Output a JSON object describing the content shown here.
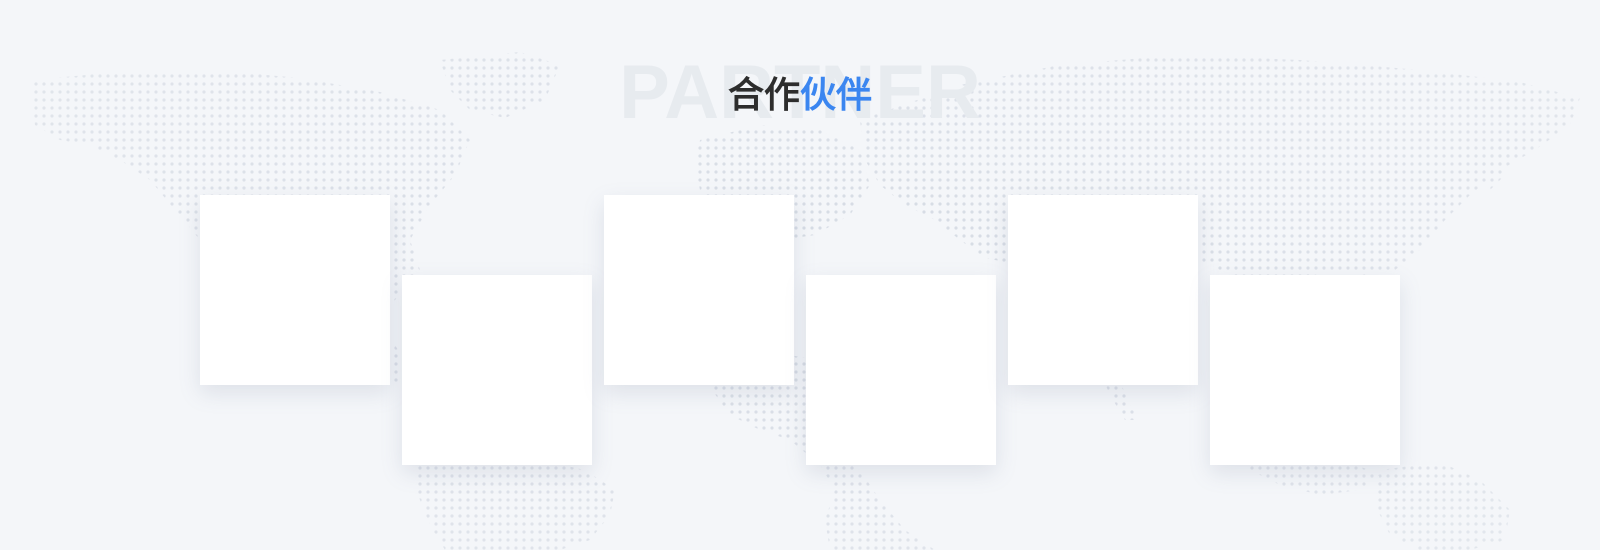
{
  "section": {
    "watermark": "PARTNER",
    "title_prefix": "合作",
    "title_highlight": "伙伴"
  },
  "colors": {
    "background": "#f4f6f9",
    "watermark": "#e7ebef",
    "title": "#2d2d2d",
    "accent": "#3b86f0",
    "card": "#ffffff",
    "map_dots": "#d3d9e2"
  },
  "partners": [
    {
      "name": ""
    },
    {
      "name": ""
    },
    {
      "name": ""
    },
    {
      "name": ""
    },
    {
      "name": ""
    },
    {
      "name": ""
    }
  ]
}
